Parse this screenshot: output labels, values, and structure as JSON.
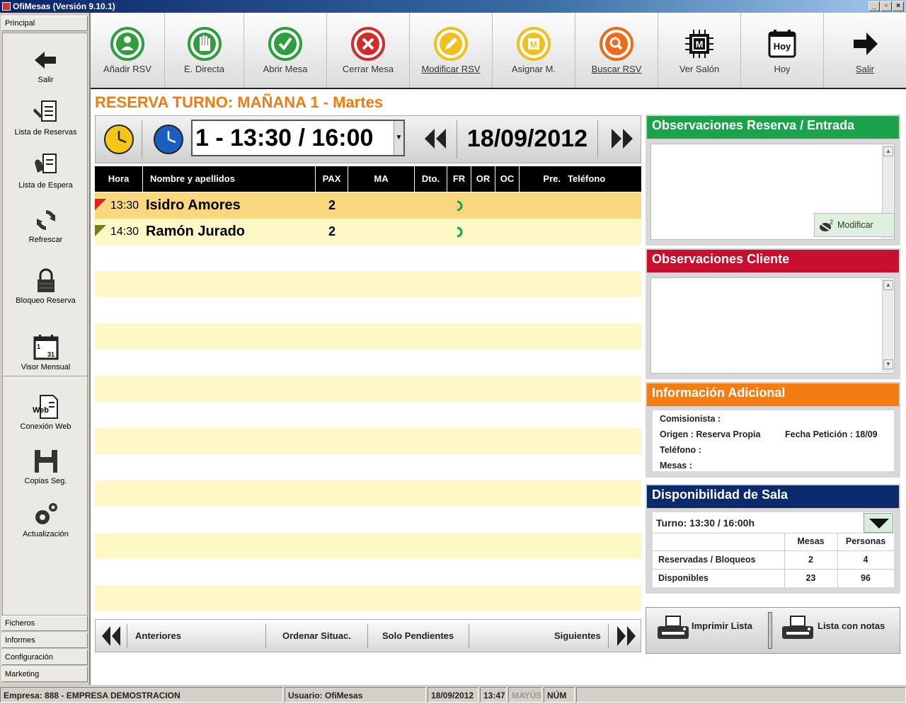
{
  "window": {
    "title": "OfiMesas (Versión 9.10.1)",
    "btn_min": "_",
    "btn_restore": "▫",
    "btn_close": "×"
  },
  "sidebar": {
    "top_tab": "Principal",
    "items": [
      {
        "label": "Salir",
        "icon": "arrow-left-icon"
      },
      {
        "label": "Lista de Reservas",
        "icon": "list-icon"
      },
      {
        "label": "Lista de Espera",
        "icon": "hand-list-icon"
      },
      {
        "label": "Refrescar",
        "icon": "refresh-icon"
      },
      {
        "label": "Bloqueo Reserva",
        "icon": "lock-icon"
      },
      {
        "label": "Visor Mensual",
        "icon": "calendar-icon",
        "cal_day1": "1",
        "cal_day31": "31"
      },
      {
        "label": "Conexión Web",
        "icon": "web-doc-icon",
        "badge": "Web"
      },
      {
        "label": "Copias Seg.",
        "icon": "backup-icon"
      },
      {
        "label": "Actualización",
        "icon": "gears-icon"
      }
    ],
    "bottom_tabs": [
      "Ficheros",
      "Informes",
      "Configuración",
      "Marketing"
    ]
  },
  "toolbar": [
    {
      "label": "Añadir RSV",
      "icon": "add-person-icon",
      "color": "#2e9e3e"
    },
    {
      "label": "E. Directa",
      "icon": "hand-icon",
      "color": "#2e9e3e"
    },
    {
      "label": "Abrir Mesa",
      "icon": "check-icon",
      "color": "#2e9e3e"
    },
    {
      "label": "Cerrar Mesa",
      "icon": "x-icon",
      "color": "#d42a2a"
    },
    {
      "label": "Modificar RSV",
      "icon": "pencil-icon",
      "color": "#f0c020"
    },
    {
      "label": "Asignar M.",
      "icon": "chip-icon",
      "color": "#f0c020"
    },
    {
      "label": "Buscar RSV",
      "icon": "search-icon",
      "color": "#ee6a1a"
    },
    {
      "label": "Ver Salón",
      "icon": "chip-m-icon",
      "color": "#111111"
    },
    {
      "label": "Hoy",
      "icon": "calendar-today-icon",
      "color": "#111111"
    },
    {
      "label": "Salir",
      "icon": "arrow-right-icon",
      "color": "#111111"
    }
  ],
  "toolbar_extra": {
    "chip_letter": "M",
    "today_badge": "Hoy"
  },
  "main": {
    "heading": "RESERVA TURNO: MAÑANA 1 - Martes",
    "turn": "1 - 13:30 / 16:00",
    "date": "18/09/2012"
  },
  "table": {
    "columns": [
      "Hora",
      "Nombre y apellidos",
      "PAX",
      "MA",
      "Dto.",
      "FR",
      "OR",
      "OC",
      "Pre.",
      "Teléfono"
    ],
    "rows": [
      {
        "hora": "13:30",
        "nombre": "Isidro Amores",
        "pax": "2",
        "flag": "#e02020"
      },
      {
        "hora": "14:30",
        "nombre": "Ramón Jurado",
        "pax": "2",
        "flag": "#7a7a1a"
      }
    ]
  },
  "bottom_nav": {
    "prev": "Anteriores",
    "sort": "Ordenar Situac.",
    "pending": "Solo Pendientes",
    "next": "Siguientes"
  },
  "panels": {
    "obs_reserva": {
      "title": "Observaciones Reserva / Entrada",
      "modify": "Modificar",
      "color": "#1aa34a"
    },
    "obs_cliente": {
      "title": "Observaciones Cliente",
      "color": "#c8102e"
    },
    "info": {
      "title": "Información Adicional",
      "color": "#f57c10",
      "comisionista": "Comisionista :",
      "origen": "Origen : Reserva Propia",
      "fecha_peticion": "Fecha Petición : 18/09",
      "telefono": "Teléfono :",
      "mesas": "Mesas :"
    },
    "dispo": {
      "title": "Disponibilidad de Sala",
      "color": "#0b2a6b",
      "turno": "Turno:  13:30 / 16:00h",
      "col_mesas": "Mesas",
      "col_personas": "Personas",
      "rows": [
        {
          "label": "Reservadas / Bloqueos",
          "mesas": "2",
          "personas": "4"
        },
        {
          "label": "Disponibles",
          "mesas": "23",
          "personas": "96"
        }
      ]
    }
  },
  "print": {
    "list": "Imprimir Lista",
    "list_notes": "Lista con notas"
  },
  "status": {
    "empresa": "Empresa: 888 - EMPRESA DEMOSTRACION",
    "usuario": "Usuario: OfiMesas",
    "fecha": "18/09/2012",
    "hora": "13:47",
    "mayus": "MAYÚS",
    "num": "NÚM"
  }
}
